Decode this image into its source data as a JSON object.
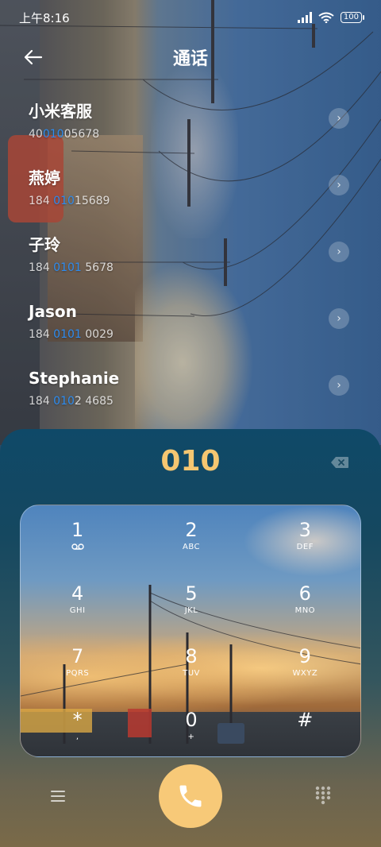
{
  "status_bar": {
    "time": "上午8:16",
    "battery": "100"
  },
  "header": {
    "title": "通话"
  },
  "contacts": [
    {
      "name": "小米客服",
      "number_pre": "40",
      "number_hl": "010",
      "number_post": "05678"
    },
    {
      "name": "燕婷",
      "number_pre": "184 ",
      "number_hl": "010",
      "number_post": "15689"
    },
    {
      "name": "子玲",
      "number_pre": "184 ",
      "number_hl": "0101",
      "number_post": " 5678"
    },
    {
      "name": "Jason",
      "number_pre": "184 ",
      "number_hl": "0101",
      "number_post": " 0029"
    },
    {
      "name": "Stephanie",
      "number_pre": "184 ",
      "number_hl": "010",
      "number_post": "2 4685"
    }
  ],
  "dialer": {
    "number": "010",
    "keys": [
      {
        "digit": "1",
        "letters": ""
      },
      {
        "digit": "2",
        "letters": "ABC"
      },
      {
        "digit": "3",
        "letters": "DEF"
      },
      {
        "digit": "4",
        "letters": "GHI"
      },
      {
        "digit": "5",
        "letters": "JKL"
      },
      {
        "digit": "6",
        "letters": "MNO"
      },
      {
        "digit": "7",
        "letters": "PQRS"
      },
      {
        "digit": "8",
        "letters": "TUV"
      },
      {
        "digit": "9",
        "letters": "WXYZ"
      },
      {
        "digit": "*",
        "letters": ","
      },
      {
        "digit": "0",
        "letters": "+"
      },
      {
        "digit": "#",
        "letters": ""
      }
    ]
  },
  "icons": {
    "back": "back-arrow-icon",
    "delete": "backspace-icon",
    "menu": "menu-icon",
    "call": "phone-icon",
    "keypad": "dialpad-icon",
    "voicemail": "voicemail-icon"
  },
  "colors": {
    "accent": "#f7c978",
    "highlight": "#2d8cf0",
    "number": "#f5c671"
  }
}
